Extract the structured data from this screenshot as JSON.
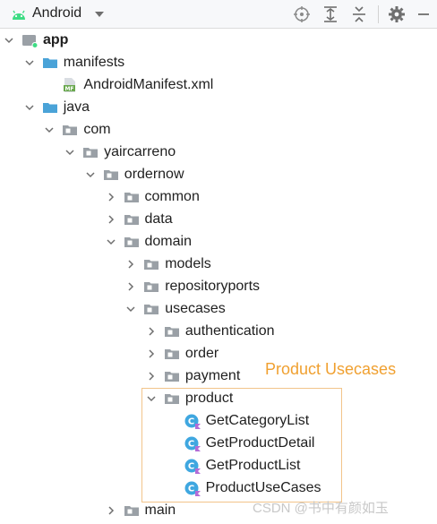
{
  "toolbar": {
    "view_label": "Android"
  },
  "tree": [
    {
      "label": "app",
      "expanded": true,
      "type": "module"
    },
    {
      "label": "manifests",
      "expanded": true,
      "type": "folder-blue"
    },
    {
      "label": "AndroidManifest.xml",
      "type": "manifest-file"
    },
    {
      "label": "java",
      "expanded": true,
      "type": "folder-blue"
    },
    {
      "label": "com",
      "expanded": true,
      "type": "package"
    },
    {
      "label": "yaircarreno",
      "expanded": true,
      "type": "package"
    },
    {
      "label": "ordernow",
      "expanded": true,
      "type": "package"
    },
    {
      "label": "common",
      "expanded": false,
      "type": "package"
    },
    {
      "label": "data",
      "expanded": false,
      "type": "package"
    },
    {
      "label": "domain",
      "expanded": true,
      "type": "package"
    },
    {
      "label": "models",
      "expanded": false,
      "type": "package"
    },
    {
      "label": "repositoryports",
      "expanded": false,
      "type": "package"
    },
    {
      "label": "usecases",
      "expanded": true,
      "type": "package"
    },
    {
      "label": "authentication",
      "expanded": false,
      "type": "package"
    },
    {
      "label": "order",
      "expanded": false,
      "type": "package"
    },
    {
      "label": "payment",
      "expanded": false,
      "type": "package"
    },
    {
      "label": "product",
      "expanded": true,
      "type": "package"
    },
    {
      "label": "GetCategoryList",
      "type": "kotlin-class"
    },
    {
      "label": "GetProductDetail",
      "type": "kotlin-class"
    },
    {
      "label": "GetProductList",
      "type": "kotlin-class"
    },
    {
      "label": "ProductUseCases",
      "type": "kotlin-class"
    },
    {
      "label": "main",
      "expanded": false,
      "type": "package"
    }
  ],
  "annotation": "Product Usecases",
  "watermark": "CSDN @书中有颜如玉",
  "colors": {
    "annotation": "#f0a030",
    "folder_blue": "#4aa3d8",
    "package_gray": "#9aa0a6",
    "kotlin_class": "#3fa7e0"
  }
}
